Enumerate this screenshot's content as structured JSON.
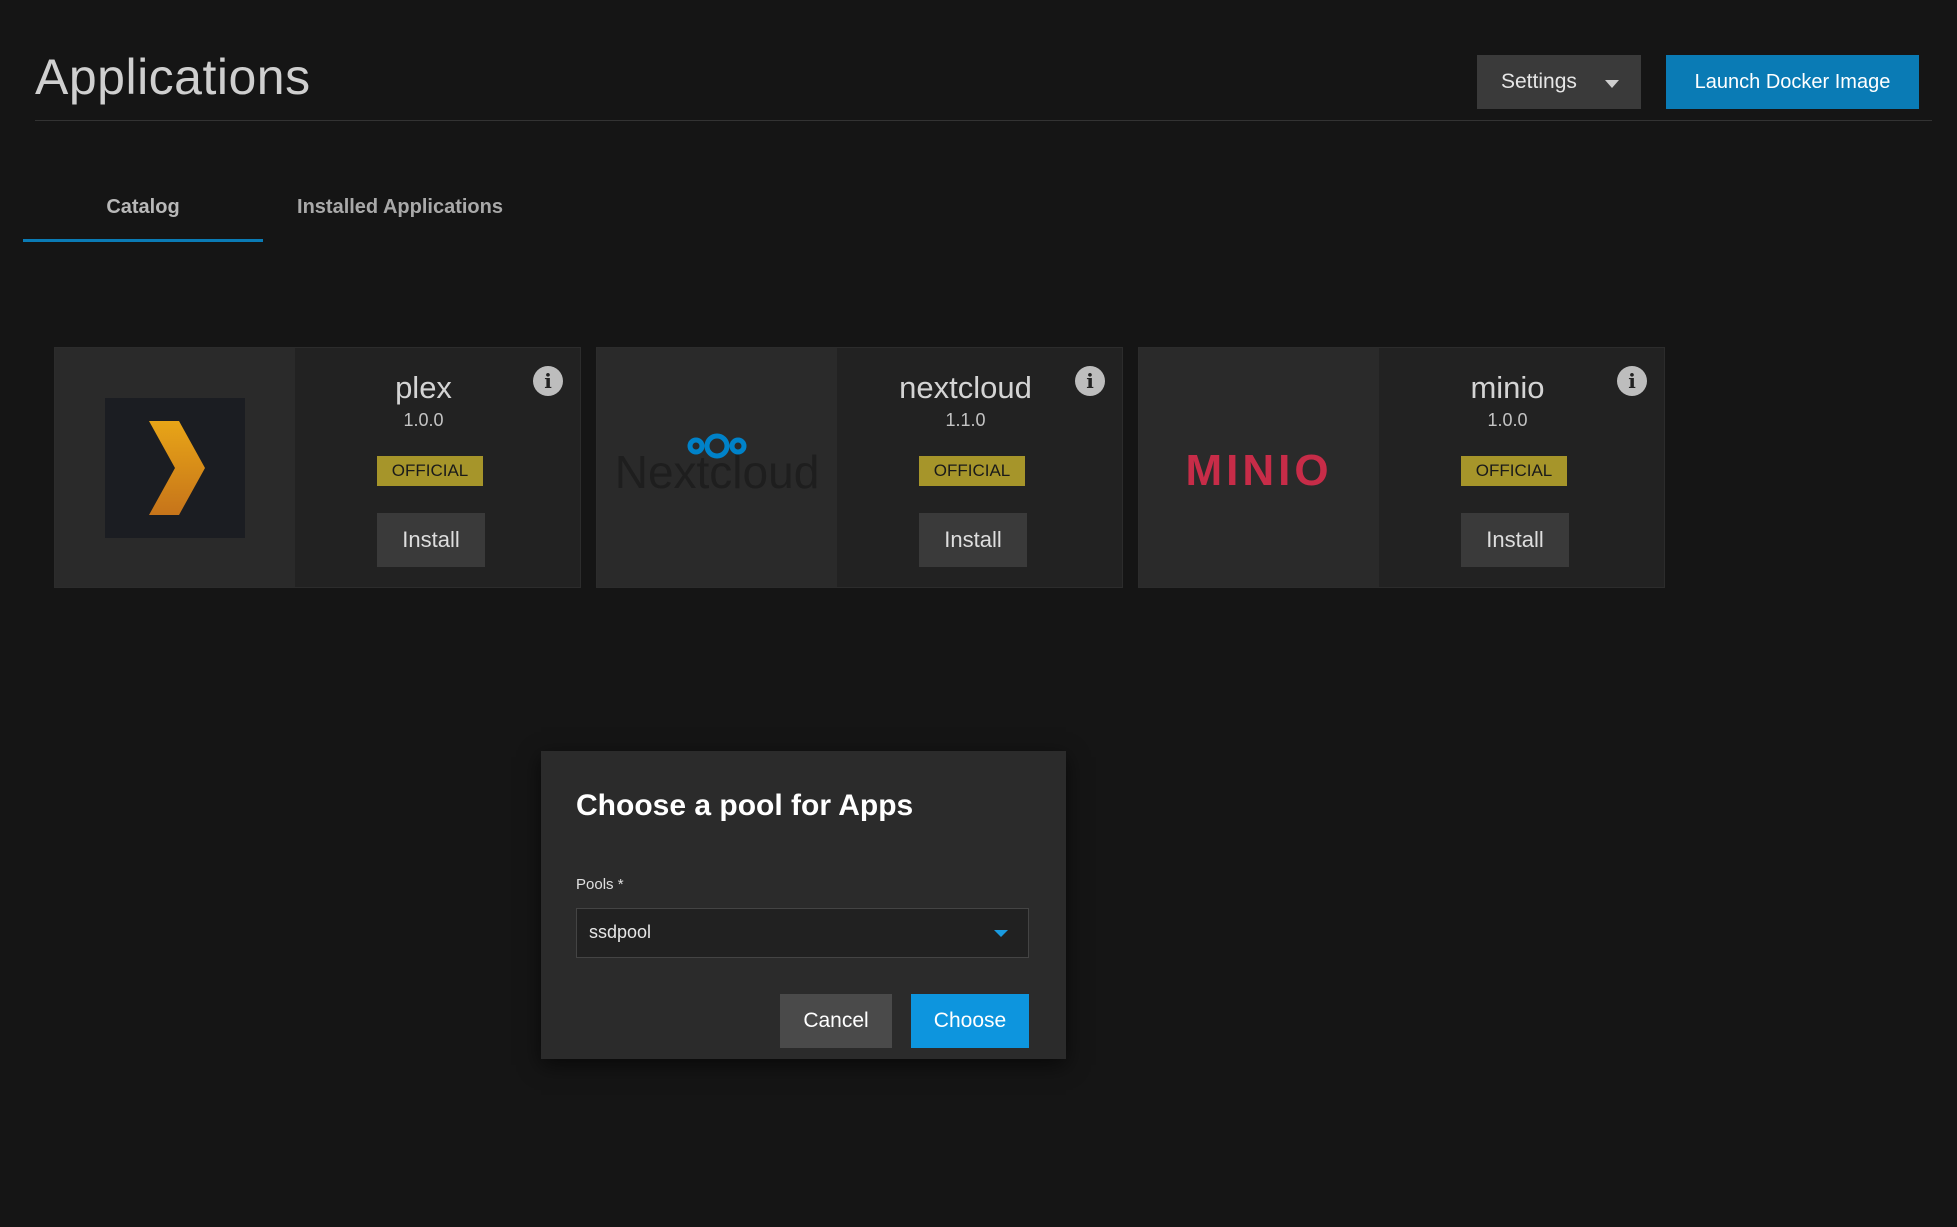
{
  "header": {
    "title": "Applications",
    "settings_label": "Settings",
    "launch_label": "Launch Docker Image"
  },
  "tabs": [
    {
      "label": "Catalog",
      "active": true
    },
    {
      "label": "Installed Applications",
      "active": false
    }
  ],
  "catalog": [
    {
      "name": "plex",
      "version": "1.0.0",
      "badge": "OFFICIAL",
      "install_label": "Install",
      "logo": "plex-chevron-logo"
    },
    {
      "name": "nextcloud",
      "version": "1.1.0",
      "badge": "OFFICIAL",
      "install_label": "Install",
      "logo": "nextcloud-logo",
      "logo_text": "Nextcloud"
    },
    {
      "name": "minio",
      "version": "1.0.0",
      "badge": "OFFICIAL",
      "install_label": "Install",
      "logo": "minio-logo",
      "logo_text": "MINIO"
    }
  ],
  "dialog": {
    "title": "Choose a pool for Apps",
    "field_label": "Pools *",
    "selected_pool": "ssdpool",
    "cancel_label": "Cancel",
    "choose_label": "Choose"
  },
  "colors": {
    "background": "#151515",
    "accent": "#0a7bb5",
    "choose_button": "#0d95de",
    "badge": "#a6952a",
    "minio_red": "#c72c48",
    "plex_orange": "#e5a00d",
    "nextcloud_blue": "#0082c9"
  }
}
